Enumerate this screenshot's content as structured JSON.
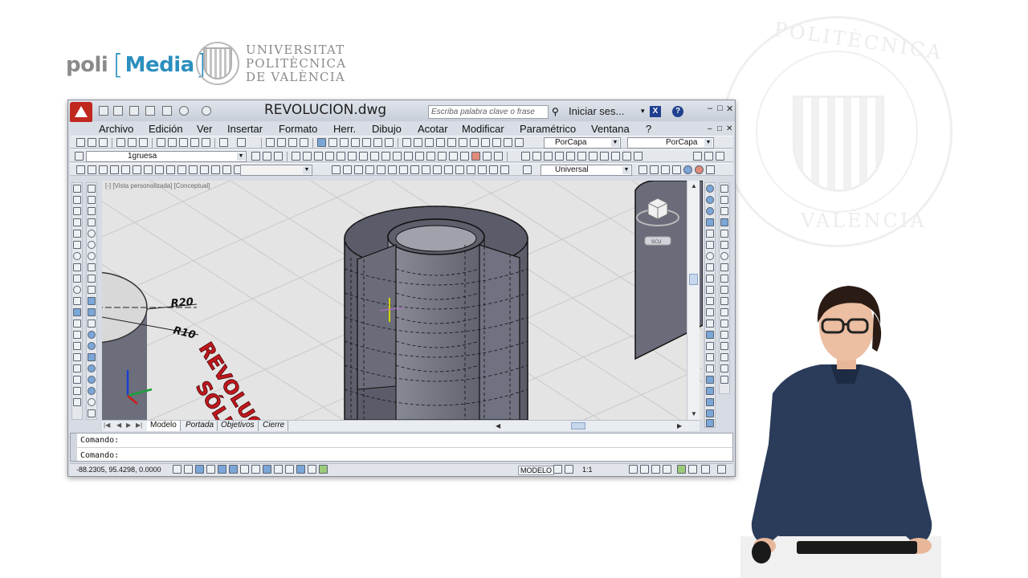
{
  "branding": {
    "polimedia_left": "poli",
    "polimedia_bracket_open": "[",
    "polimedia_right": "Media",
    "polimedia_bracket_close": "]",
    "upv_line1": "UNIVERSITAT",
    "upv_line2": "POLITÈCNICA",
    "upv_line3": "DE VALÈNCIA",
    "watermark_text_1": "POLITÈCNICA",
    "watermark_text_2": "VALÈNCIA"
  },
  "window": {
    "title": "REVOLUCION.dwg",
    "search_placeholder": "Escriba palabra clave o frase",
    "sign_in": "Iniciar ses...",
    "help": "?",
    "minimize": "–",
    "restore": "□",
    "close": "✕"
  },
  "menu": {
    "items": [
      "Archivo",
      "Edición",
      "Ver",
      "Insertar",
      "Formato",
      "Herr.",
      "Dibujo",
      "Acotar",
      "Modificar",
      "Paramétrico",
      "Ventana",
      "?"
    ]
  },
  "toolbars": {
    "color_combo": "PorCapa",
    "linetype_combo": "PorCapa",
    "layer_combo": "1gruesa",
    "ucs_combo": "Universal"
  },
  "viewport": {
    "label": "[-] [Vista personalizada] [Conceptual]",
    "dim_r20": "R20",
    "dim_r10": "R10",
    "text_revolucion": "REVOLUCIÓN",
    "text_solidos": "SÓLIDOS",
    "ucs_label": "SCU"
  },
  "tabs": {
    "items": [
      "Modelo",
      "Portada",
      "Objetivos",
      "Cierre"
    ],
    "active": "Modelo"
  },
  "command": {
    "history": "Comando:",
    "prompt": "Comando:"
  },
  "status": {
    "coordinates": "-88.2305, 95.4298, 0.0000",
    "model": "MODELO",
    "scale": "1:1"
  },
  "colors": {
    "accent_blue": "#2b8fbf",
    "app_red": "#c0281e",
    "model_gray": "#6c6e7c"
  }
}
